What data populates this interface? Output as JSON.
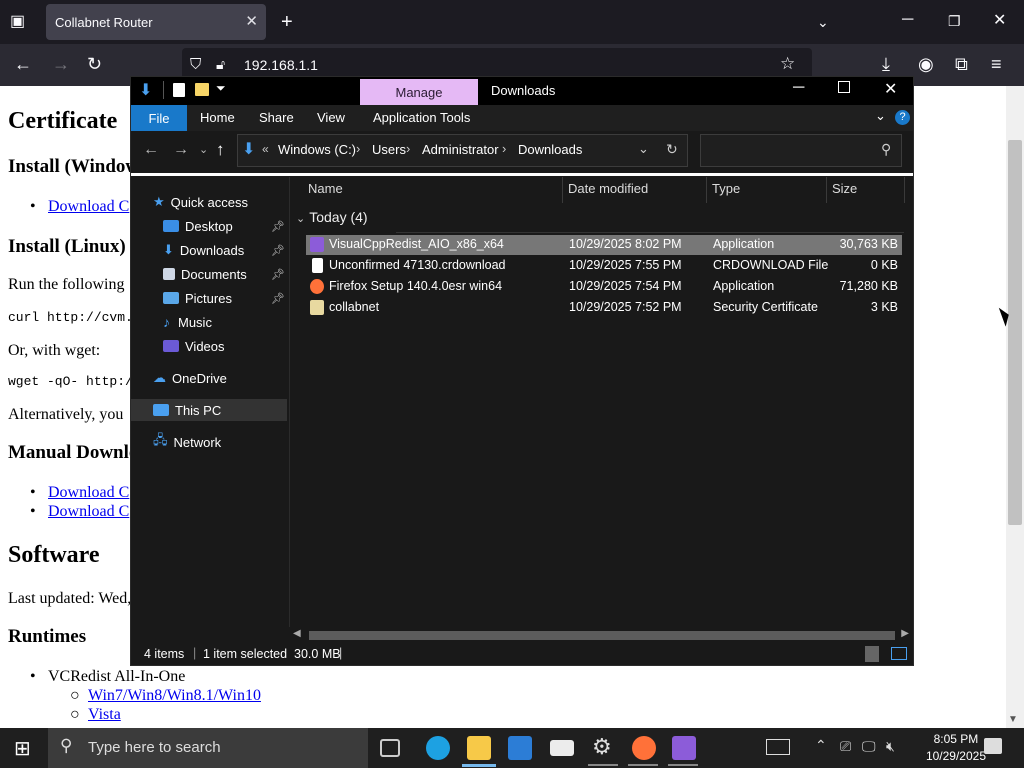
{
  "browser": {
    "tab_title": "Collabnet Router",
    "url": "192.168.1.1"
  },
  "webpage": {
    "h_certificate": "Certificate",
    "h_install_windows": "Install (Window",
    "link_download1": "Download C",
    "h_install_linux": "Install (Linux)",
    "run_following": "Run the following",
    "curl_cmd": "curl http://cvm.l",
    "or_wget": "Or, with wget:",
    "wget_cmd": "wget -qO- http:/",
    "alternatively": "Alternatively, you",
    "h_manual": "Manual Downlo",
    "link_download2": "Download C",
    "link_download3": "Download C",
    "h_software": "Software",
    "last_updated": "Last updated: Wed,",
    "h_runtimes": "Runtimes",
    "vcredist": "VCRedist All-In-One",
    "link_win": "Win7/Win8/Win8.1/Win10",
    "link_vista": "Vista"
  },
  "explorer": {
    "manage_label": "Manage",
    "title": "Downloads",
    "ribbon_tabs": [
      "File",
      "Home",
      "Share",
      "View",
      "Application Tools"
    ],
    "breadcrumb": [
      "Windows (C:)",
      "Users",
      "Administrator",
      "Downloads"
    ],
    "nav": {
      "quick_access": "Quick access",
      "desktop": "Desktop",
      "downloads": "Downloads",
      "documents": "Documents",
      "pictures": "Pictures",
      "music": "Music",
      "videos": "Videos",
      "onedrive": "OneDrive",
      "thispc": "This PC",
      "network": "Network"
    },
    "columns": {
      "name": "Name",
      "date": "Date modified",
      "type": "Type",
      "size": "Size"
    },
    "group_label": "Today (4)",
    "files": [
      {
        "name": "VisualCppRedist_AIO_x86_x64",
        "date": "10/29/2025 8:02 PM",
        "type": "Application",
        "size": "30,763 KB",
        "selected": true,
        "icon_color": "#8c5cd9"
      },
      {
        "name": "Unconfirmed 47130.crdownload",
        "date": "10/29/2025 7:55 PM",
        "type": "CRDOWNLOAD File",
        "size": "0 KB",
        "selected": false,
        "icon_color": "#ffffff"
      },
      {
        "name": "Firefox Setup 140.4.0esr win64",
        "date": "10/29/2025 7:54 PM",
        "type": "Application",
        "size": "71,280 KB",
        "selected": false,
        "icon_color": "#ff7139"
      },
      {
        "name": "collabnet",
        "date": "10/29/2025 7:52 PM",
        "type": "Security Certificate",
        "size": "3 KB",
        "selected": false,
        "icon_color": "#e8d9a0"
      }
    ],
    "status": {
      "items": "4 items",
      "selected": "1 item selected  30.0 MB"
    }
  },
  "taskbar": {
    "search_placeholder": "Type here to search",
    "time": "8:05 PM",
    "date": "10/29/2025"
  }
}
